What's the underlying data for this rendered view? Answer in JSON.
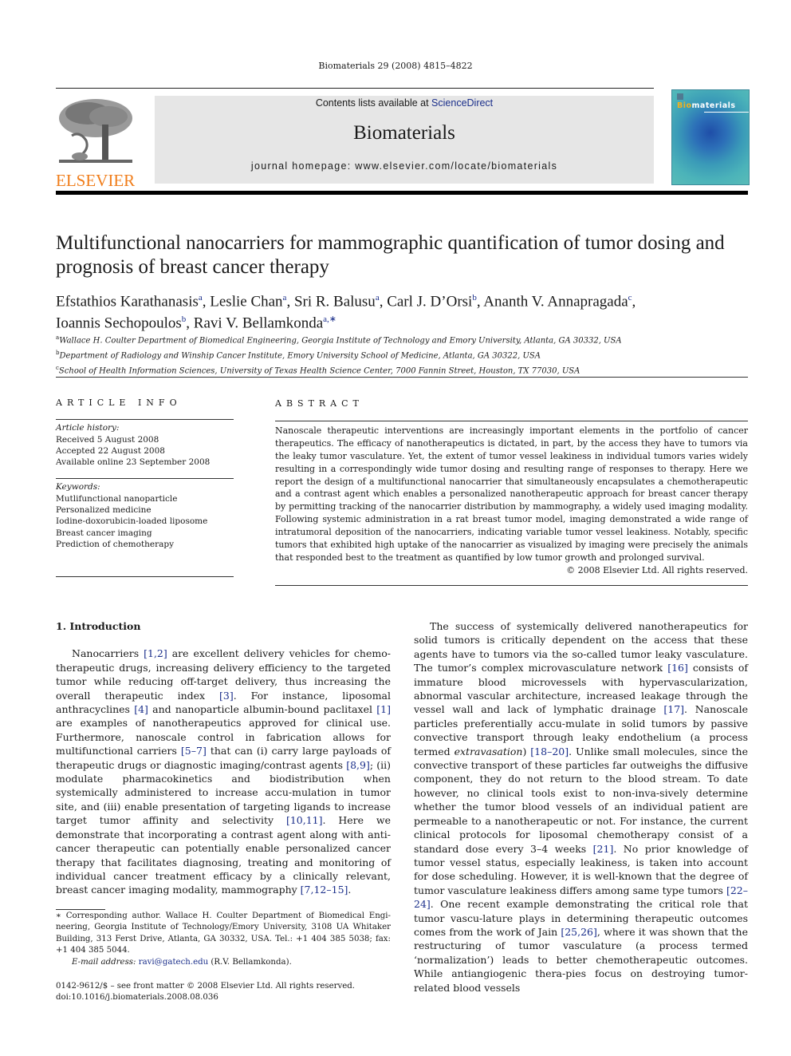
{
  "header": {
    "journal_ref": "Biomaterials 29 (2008) 4815–4822",
    "contents_prefix": "Contents lists available at ",
    "sciencedirect_link": "ScienceDirect",
    "journal_name": "Biomaterials",
    "homepage": "journal homepage: www.elsevier.com/locate/biomaterials",
    "publisher_logo_text": "ELSEVIER",
    "cover": {
      "title_highlight": "Bio",
      "title_rest": "materials"
    },
    "colors": {
      "elsevier_orange": "#f07d1a",
      "link_blue": "#1b2f8b",
      "banner_gray": "#e6e6e6"
    }
  },
  "article": {
    "title": "Multifunctional nanocarriers for mammographic quantification of tumor dosing and prognosis of breast cancer therapy",
    "authors": [
      {
        "name": "Efstathios Karathanasis",
        "aff": "a",
        "sep": ", "
      },
      {
        "name": "Leslie Chan",
        "aff": "a",
        "sep": ", "
      },
      {
        "name": "Sri R. Balusu",
        "aff": "a",
        "sep": ", "
      },
      {
        "name": "Carl J. D’Orsi",
        "aff": "b",
        "sep": ", "
      },
      {
        "name": "Ananth V. Annapragada",
        "aff": "c",
        "sep": ", "
      },
      {
        "name": "Ioannis Sechopoulos",
        "aff": "b",
        "sep": ", "
      },
      {
        "name": "Ravi V. Bellamkonda",
        "aff": "a,∗",
        "sep": ""
      }
    ],
    "affiliations": [
      {
        "key": "a",
        "text": "Wallace H. Coulter Department of Biomedical Engineering, Georgia Institute of Technology and Emory University, Atlanta, GA 30332, USA"
      },
      {
        "key": "b",
        "text": "Department of Radiology and Winship Cancer Institute, Emory University School of Medicine, Atlanta, GA 30322, USA"
      },
      {
        "key": "c",
        "text": "School of Health Information Sciences, University of Texas Health Science Center, 7000 Fannin Street, Houston, TX 77030, USA"
      }
    ]
  },
  "article_info": {
    "heading": "ARTICLE INFO",
    "history_label": "Article history:",
    "history": [
      "Received 5 August 2008",
      "Accepted 22 August 2008",
      "Available online 23 September 2008"
    ],
    "keywords_label": "Keywords:",
    "keywords": [
      "Mutlifunctional nanoparticle",
      "Personalized medicine",
      "Iodine-doxorubicin-loaded liposome",
      "Breast cancer imaging",
      "Prediction of chemotherapy"
    ]
  },
  "abstract": {
    "heading": "ABSTRACT",
    "text": "Nanoscale therapeutic interventions are increasingly important elements in the portfolio of cancer therapeutics. The efficacy of nanotherapeutics is dictated, in part, by the access they have to tumors via the leaky tumor vasculature. Yet, the extent of tumor vessel leakiness in individual tumors varies widely resulting in a correspondingly wide tumor dosing and resulting range of responses to therapy. Here we report the design of a multifunctional nanocarrier that simultaneously encapsulates a chemotherapeutic and a contrast agent which enables a personalized nanotherapeutic approach for breast cancer therapy by permitting tracking of the nanocarrier distribution by mammography, a widely used imaging modality. Following systemic administration in a rat breast tumor model, imaging demonstrated a wide range of intratumoral deposition of the nanocarriers, indicating variable tumor vessel leakiness. Notably, specific tumors that exhibited high uptake of the nanocarrier as visualized by imaging were precisely the animals that responded best to the treatment as quantified by low tumor growth and prolonged survival.",
    "copyright": "© 2008 Elsevier Ltd. All rights reserved."
  },
  "body": {
    "section_title": "1.  Introduction",
    "col1_para": [
      {
        "t": "Nanocarriers "
      },
      {
        "r": "[1,2]"
      },
      {
        "t": " are excellent delivery vehicles for chemo-therapeutic drugs, increasing delivery efficiency to the targeted tumor while reducing off-target delivery, thus increasing the overall therapeutic index "
      },
      {
        "r": "[3]"
      },
      {
        "t": ". For instance, liposomal anthracyclines "
      },
      {
        "r": "[4]"
      },
      {
        "t": " and nanoparticle albumin-bound paclitaxel "
      },
      {
        "r": "[1]"
      },
      {
        "t": " are examples of nanotherapeutics approved for clinical use. Furthermore, nanoscale control in fabrication allows for multifunctional carriers "
      },
      {
        "r": "[5–7]"
      },
      {
        "t": " that can (i) carry large payloads of therapeutic drugs or diagnostic imaging/contrast agents "
      },
      {
        "r": "[8,9]"
      },
      {
        "t": "; (ii) modulate pharmacokinetics and biodistribution when systemically administered to increase accu-mulation in tumor site, and (iii) enable presentation of targeting ligands to increase target tumor affinity and selectivity "
      },
      {
        "r": "[10,11]"
      },
      {
        "t": ". Here we demonstrate that incorporating a contrast agent along with anti-cancer therapeutic can potentially enable personalized cancer therapy that facilitates diagnosing, treating and monitoring of individual cancer treatment efficacy by a clinically relevant, breast cancer imaging modality, mammography "
      },
      {
        "r": "[7,12–15]"
      },
      {
        "t": "."
      }
    ],
    "col2_para": [
      {
        "t": "The success of systemically delivered nanotherapeutics for solid tumors is critically dependent on the access that these agents have to tumors via the so-called tumor leaky vasculature. The tumor’s complex microvasculature network "
      },
      {
        "r": "[16]"
      },
      {
        "t": " consists of immature blood microvessels with hypervascularization, abnormal vascular architecture, increased leakage through the vessel wall and lack of lymphatic drainage "
      },
      {
        "r": "[17]"
      },
      {
        "t": ". Nanoscale particles preferentially accu-mulate in solid tumors by passive convective transport through leaky endothelium (a process termed "
      },
      {
        "i": "extravasation"
      },
      {
        "t": ") "
      },
      {
        "r": "[18–20]"
      },
      {
        "t": ". Unlike small molecules, since the convective transport of these particles far outweighs the diffusive component, they do not return to the blood stream. To date however, no clinical tools exist to non-inva-sively determine whether the tumor blood vessels of an individual patient are permeable to a nanotherapeutic or not. For instance, the current clinical protocols for liposomal chemotherapy consist of a standard dose every 3–4 weeks "
      },
      {
        "r": "[21]"
      },
      {
        "t": ". No prior knowledge of tumor vessel status, especially leakiness, is taken into account for dose scheduling. However, it is well-known that the degree of tumor vasculature leakiness differs among same type tumors "
      },
      {
        "r": "[22–24]"
      },
      {
        "t": ". One recent example demonstrating the critical role that tumor vascu-lature plays in determining therapeutic outcomes comes from the work of Jain "
      },
      {
        "r": "[25,26]"
      },
      {
        "t": ", where it was shown that the restructuring of tumor vasculature (a process termed ‘normalization’) leads to better chemotherapeutic outcomes. While antiangiogenic thera-pies focus on destroying tumor-related blood vessels"
      }
    ]
  },
  "footnote": {
    "corresponding": "∗ Corresponding author. Wallace H. Coulter Department of Biomedical Engi-neering, Georgia Institute of Technology/Emory University, 3108 UA Whitaker Building, 313 Ferst Drive, Atlanta, GA 30332, USA. Tel.: +1 404 385 5038; fax: +1 404 385 5044.",
    "email_label": "E-mail address: ",
    "email": "ravi@gatech.edu",
    "email_suffix": " (R.V. Bellamkonda)."
  },
  "front_matter": {
    "issn_line": "0142-9612/$ – see front matter © 2008 Elsevier Ltd. All rights reserved.",
    "doi": "doi:10.1016/j.biomaterials.2008.08.036"
  }
}
